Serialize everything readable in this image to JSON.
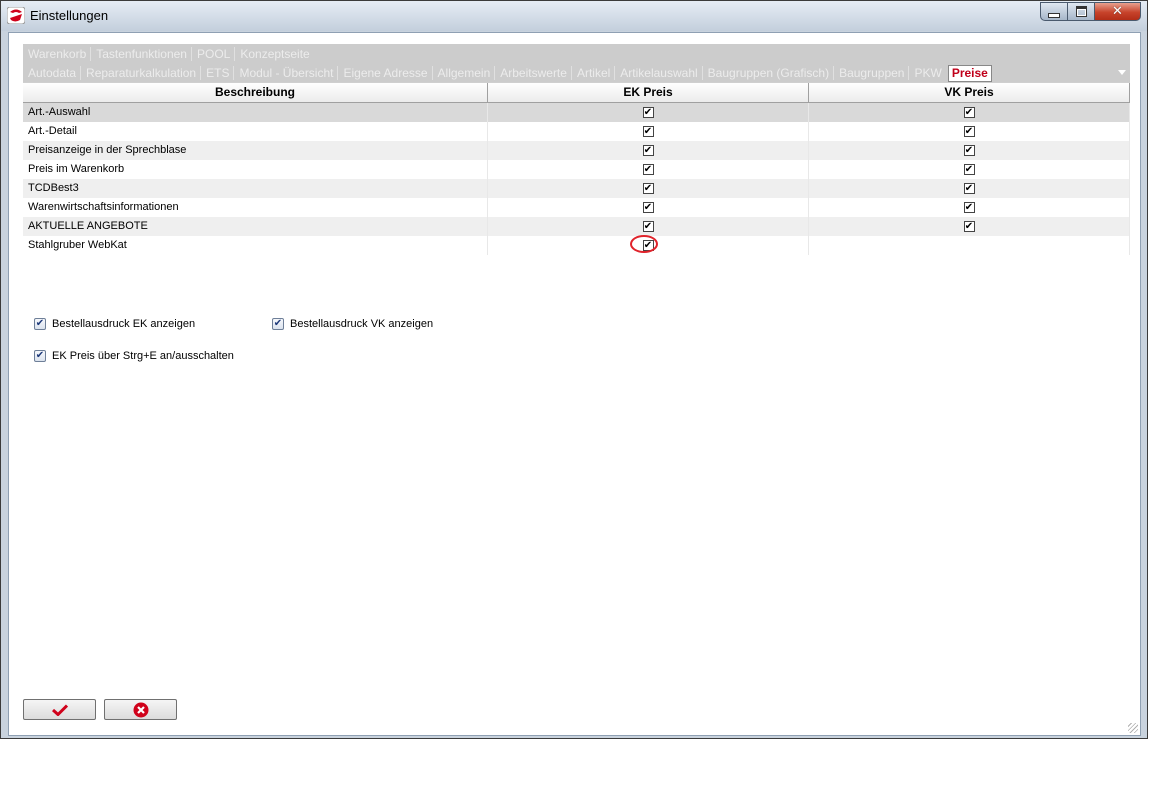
{
  "window": {
    "title": "Einstellungen",
    "icons": {
      "app": "app-logo-icon",
      "minimize": "minimize-icon",
      "maximize": "maximize-icon",
      "close": "close-icon"
    }
  },
  "tabs": {
    "row1": [
      "Warenkorb",
      "Tastenfunktionen",
      "POOL",
      "Konzeptseite"
    ],
    "row2": [
      "Autodata",
      "Reparaturkalkulation",
      "ETS",
      "Modul - Übersicht",
      "Eigene Adresse",
      "Allgemein",
      "Arbeitswerte",
      "Artikel",
      "Artikelauswahl",
      "Baugruppen (Grafisch)",
      "Baugruppen",
      "PKW"
    ],
    "active": "Preise",
    "active_color": "#c0001a"
  },
  "table": {
    "headers": {
      "description": "Beschreibung",
      "ek": "EK Preis",
      "vk": "VK Preis"
    },
    "rows": [
      {
        "label": "Art.-Auswahl",
        "ek": true,
        "vk": true
      },
      {
        "label": "Art.-Detail",
        "ek": true,
        "vk": true
      },
      {
        "label": "Preisanzeige in der Sprechblase",
        "ek": true,
        "vk": true
      },
      {
        "label": "Preis im Warenkorb",
        "ek": true,
        "vk": true
      },
      {
        "label": "TCDBest3",
        "ek": true,
        "vk": true
      },
      {
        "label": "Warenwirtschaftsinformationen",
        "ek": true,
        "vk": true
      },
      {
        "label": "AKTUELLE ANGEBOTE",
        "ek": true,
        "vk": true
      },
      {
        "label": "Stahlgruber WebKat",
        "ek": true,
        "vk": false
      }
    ],
    "highlight_color": "#e0232b"
  },
  "options": {
    "bestell_ek": {
      "label": "Bestellausdruck EK anzeigen",
      "checked": true
    },
    "bestell_vk": {
      "label": "Bestellausdruck VK anzeigen",
      "checked": true
    },
    "ek_toggle": {
      "label": "EK Preis über Strg+E an/ausschalten",
      "checked": true
    }
  },
  "buttons": {
    "ok_icon": "checkmark-icon",
    "cancel_icon": "cancel-circle-icon",
    "ok_color": "#d0021b",
    "cancel_color": "#d0021b"
  }
}
